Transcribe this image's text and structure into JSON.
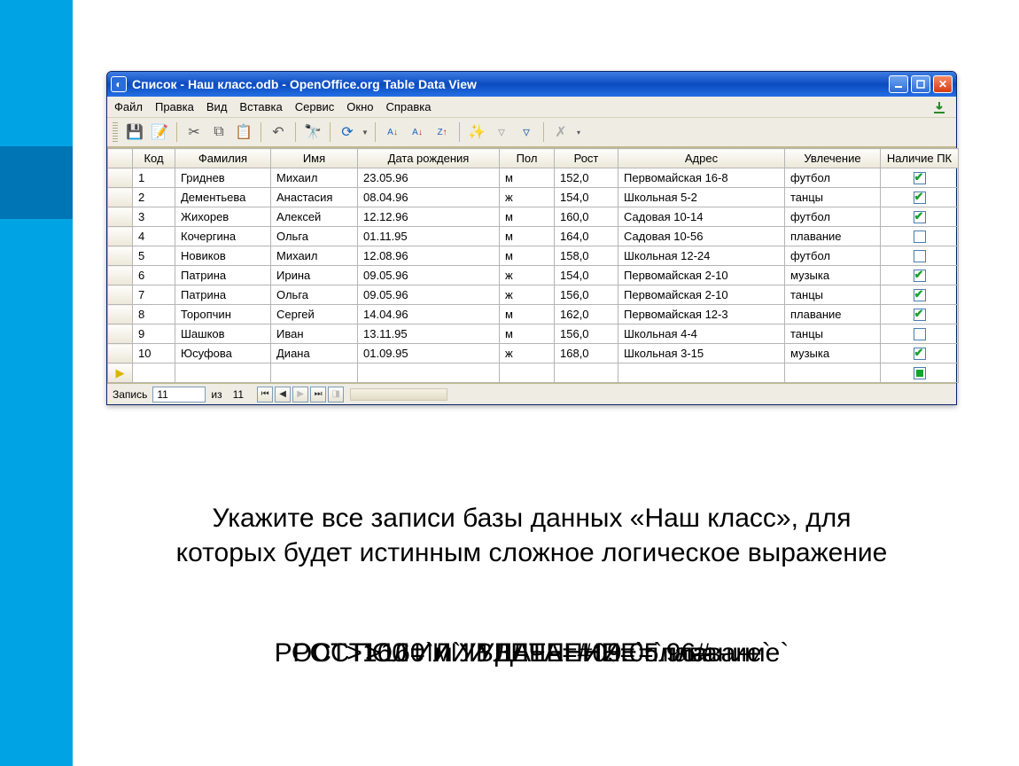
{
  "window": {
    "title": "Список - Наш класс.odb - OpenOffice.org Table Data View"
  },
  "menu": {
    "file": "Файл",
    "edit": "Правка",
    "view": "Вид",
    "insert": "Вставка",
    "service": "Сервис",
    "window": "Окно",
    "help": "Справка"
  },
  "columns": {
    "kod": "Код",
    "familiya": "Фамилия",
    "imya": "Имя",
    "data": "Дата рождения",
    "pol": "Пол",
    "rost": "Рост",
    "adres": "Адрес",
    "uvlechenie": "Увлечение",
    "pk": "Наличие ПК"
  },
  "rows": [
    {
      "kod": "1",
      "familiya": "Гриднев",
      "imya": "Михаил",
      "data": "23.05.96",
      "pol": "м",
      "rost": "152,0",
      "adres": "Первомайская 16-8",
      "uvlechenie": "футбол",
      "pk": true
    },
    {
      "kod": "2",
      "familiya": "Дементьева",
      "imya": "Анастасия",
      "data": "08.04.96",
      "pol": "ж",
      "rost": "154,0",
      "adres": "Школьная 5-2",
      "uvlechenie": "танцы",
      "pk": true
    },
    {
      "kod": "3",
      "familiya": "Жихорев",
      "imya": "Алексей",
      "data": "12.12.96",
      "pol": "м",
      "rost": "160,0",
      "adres": "Садовая 10-14",
      "uvlechenie": "футбол",
      "pk": true
    },
    {
      "kod": "4",
      "familiya": "Кочергина",
      "imya": "Ольга",
      "data": "01.11.95",
      "pol": "м",
      "rost": "164,0",
      "adres": "Садовая 10-56",
      "uvlechenie": "плавание",
      "pk": false
    },
    {
      "kod": "5",
      "familiya": "Новиков",
      "imya": "Михаил",
      "data": "12.08.96",
      "pol": "м",
      "rost": "158,0",
      "adres": "Школьная 12-24",
      "uvlechenie": "футбол",
      "pk": false
    },
    {
      "kod": "6",
      "familiya": "Патрина",
      "imya": "Ирина",
      "data": "09.05.96",
      "pol": "ж",
      "rost": "154,0",
      "adres": "Первомайская 2-10",
      "uvlechenie": "музыка",
      "pk": true
    },
    {
      "kod": "7",
      "familiya": "Патрина",
      "imya": "Ольга",
      "data": "09.05.96",
      "pol": "ж",
      "rost": "156,0",
      "adres": "Первомайская 2-10",
      "uvlechenie": "танцы",
      "pk": true
    },
    {
      "kod": "8",
      "familiya": "Торопчин",
      "imya": "Сергей",
      "data": "14.04.96",
      "pol": "м",
      "rost": "162,0",
      "adres": "Первомайская 12-3",
      "uvlechenie": "плавание",
      "pk": true
    },
    {
      "kod": "9",
      "familiya": "Шашков",
      "imya": "Иван",
      "data": "13.11.95",
      "pol": "м",
      "rost": "156,0",
      "adres": "Школьная 4-4",
      "uvlechenie": "танцы",
      "pk": false
    },
    {
      "kod": "10",
      "familiya": "Юсуфова",
      "imya": "Диана",
      "data": "01.09.95",
      "pol": "ж",
      "rost": "168,0",
      "adres": "Школьная 3-15",
      "uvlechenie": "музыка",
      "pk": true
    }
  ],
  "nav": {
    "label": "Запись",
    "current": "11",
    "of": "из",
    "total": "11"
  },
  "question": {
    "line1": "Укажите все записи базы данных «Наш класс», для",
    "line2": "которых будет истинным сложное логическое выражение"
  },
  "expressions": {
    "a": "РОСТ>160 И УВЛЕЧЕНИЕ=`плавание`",
    "b": "РОСТ>160 ИЛИ УВЛЕЧЕНИЕ=`плавание`",
    "c": "ПОЛ=`м` И ДАТА=#09.05.96#"
  }
}
